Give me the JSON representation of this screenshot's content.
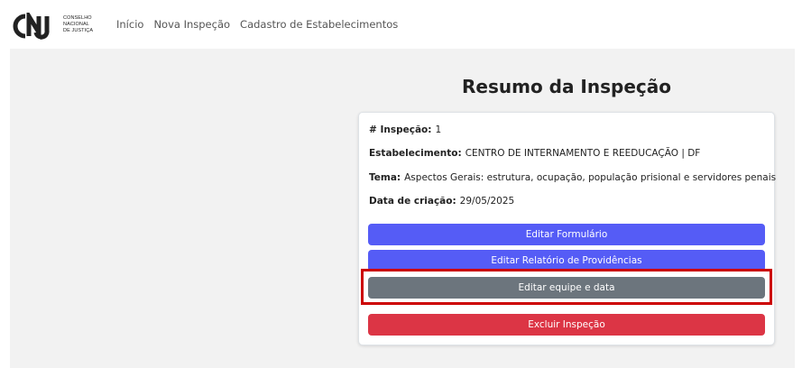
{
  "brand": {
    "logo_mark": "CNJ",
    "logo_lines": [
      "CONSELHO",
      "NACIONAL",
      "DE JUSTIÇA"
    ]
  },
  "nav": {
    "items": [
      "Início",
      "Nova Inspeção",
      "Cadastro de Estabelecimentos"
    ]
  },
  "page": {
    "title": "Resumo da Inspeção"
  },
  "summary": {
    "inspection_label": "# Inspeção:",
    "inspection_value": "1",
    "establishment_label": "Estabelecimento:",
    "establishment_value": "CENTRO DE INTERNAMENTO E REEDUCAÇÃO | DF",
    "theme_label": "Tema:",
    "theme_value": "Aspectos Gerais: estrutura, ocupação, população prisional e servidores penais",
    "date_label": "Data de criação:",
    "date_value": "29/05/2025"
  },
  "actions": {
    "edit_form": "Editar Formulário",
    "edit_report": "Editar Relatório de Providências",
    "edit_team": "Editar equipe e data",
    "delete": "Excluir Inspeção"
  },
  "colors": {
    "primary": "#555cf6",
    "secondary": "#6c757d",
    "danger": "#dc3545",
    "highlight": "#cc0000"
  }
}
